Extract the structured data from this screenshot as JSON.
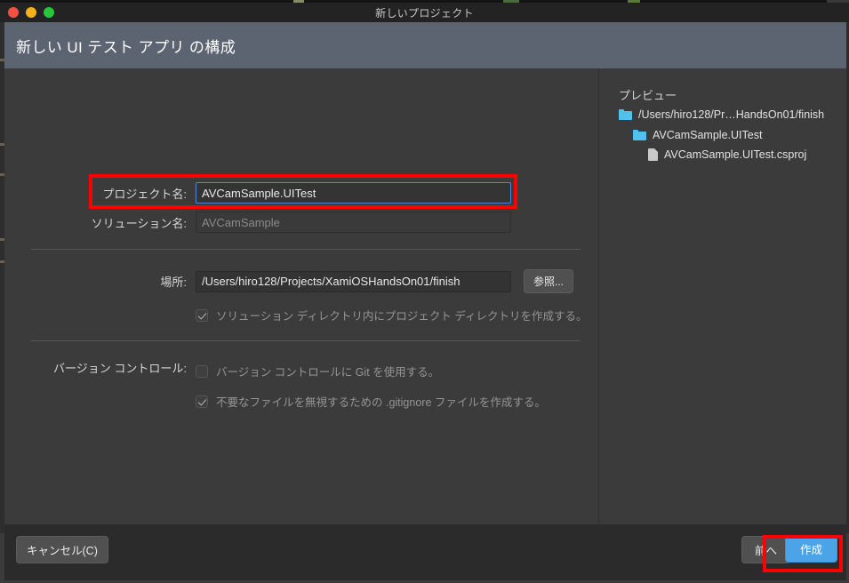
{
  "window": {
    "title": "新しいプロジェクト",
    "traffic_lights": [
      "close-red",
      "minimize-amber",
      "zoom-green"
    ]
  },
  "header": {
    "title": "新しい UI テスト アプリ の構成"
  },
  "form": {
    "project_name": {
      "label": "プロジェクト名:",
      "value": "AVCamSample.UITest",
      "placeholder": "",
      "focused": true,
      "highlighted": true
    },
    "solution_name": {
      "label": "ソリューション名:",
      "value": "AVCamSample",
      "placeholder": "",
      "disabled": true
    },
    "location": {
      "label": "場所:",
      "value": "/Users/hiro128/Projects/XamiOSHandsOn01/finish",
      "placeholder": "",
      "browse_label": "参照..."
    },
    "create_project_dir": {
      "label": "ソリューション ディレクトリ内にプロジェクト ディレクトリを作成する。",
      "checked": true,
      "disabled": true
    },
    "version_control": {
      "label": "バージョン コントロール:",
      "use_git": {
        "label": "バージョン コントロールに Git を使用する。",
        "checked": false,
        "disabled": true
      },
      "gitignore": {
        "label": "不要なファイルを無視するための .gitignore ファイルを作成する。",
        "checked": true,
        "disabled": true
      }
    }
  },
  "preview": {
    "title": "プレビュー",
    "tree": [
      {
        "icon": "folder-icon",
        "label": "/Users/hiro128/Pr…HandsOn01/finish",
        "depth": 0
      },
      {
        "icon": "folder-icon",
        "label": "AVCamSample.UITest",
        "depth": 1
      },
      {
        "icon": "file-icon",
        "label": "AVCamSample.UITest.csproj",
        "depth": 2
      }
    ]
  },
  "footer": {
    "cancel_label": "キャンセル(C)",
    "back_label": "前へ",
    "create_label": "作成",
    "create_highlighted": true
  },
  "colors": {
    "accent_blue": "#4ba3e8",
    "header_band": "#5c6371",
    "annotation_red": "#fe0000",
    "folder_cyan": "#4ec3ef",
    "dialog_bg": "#3b3b3b",
    "footer_bg": "#2b2b2b"
  }
}
